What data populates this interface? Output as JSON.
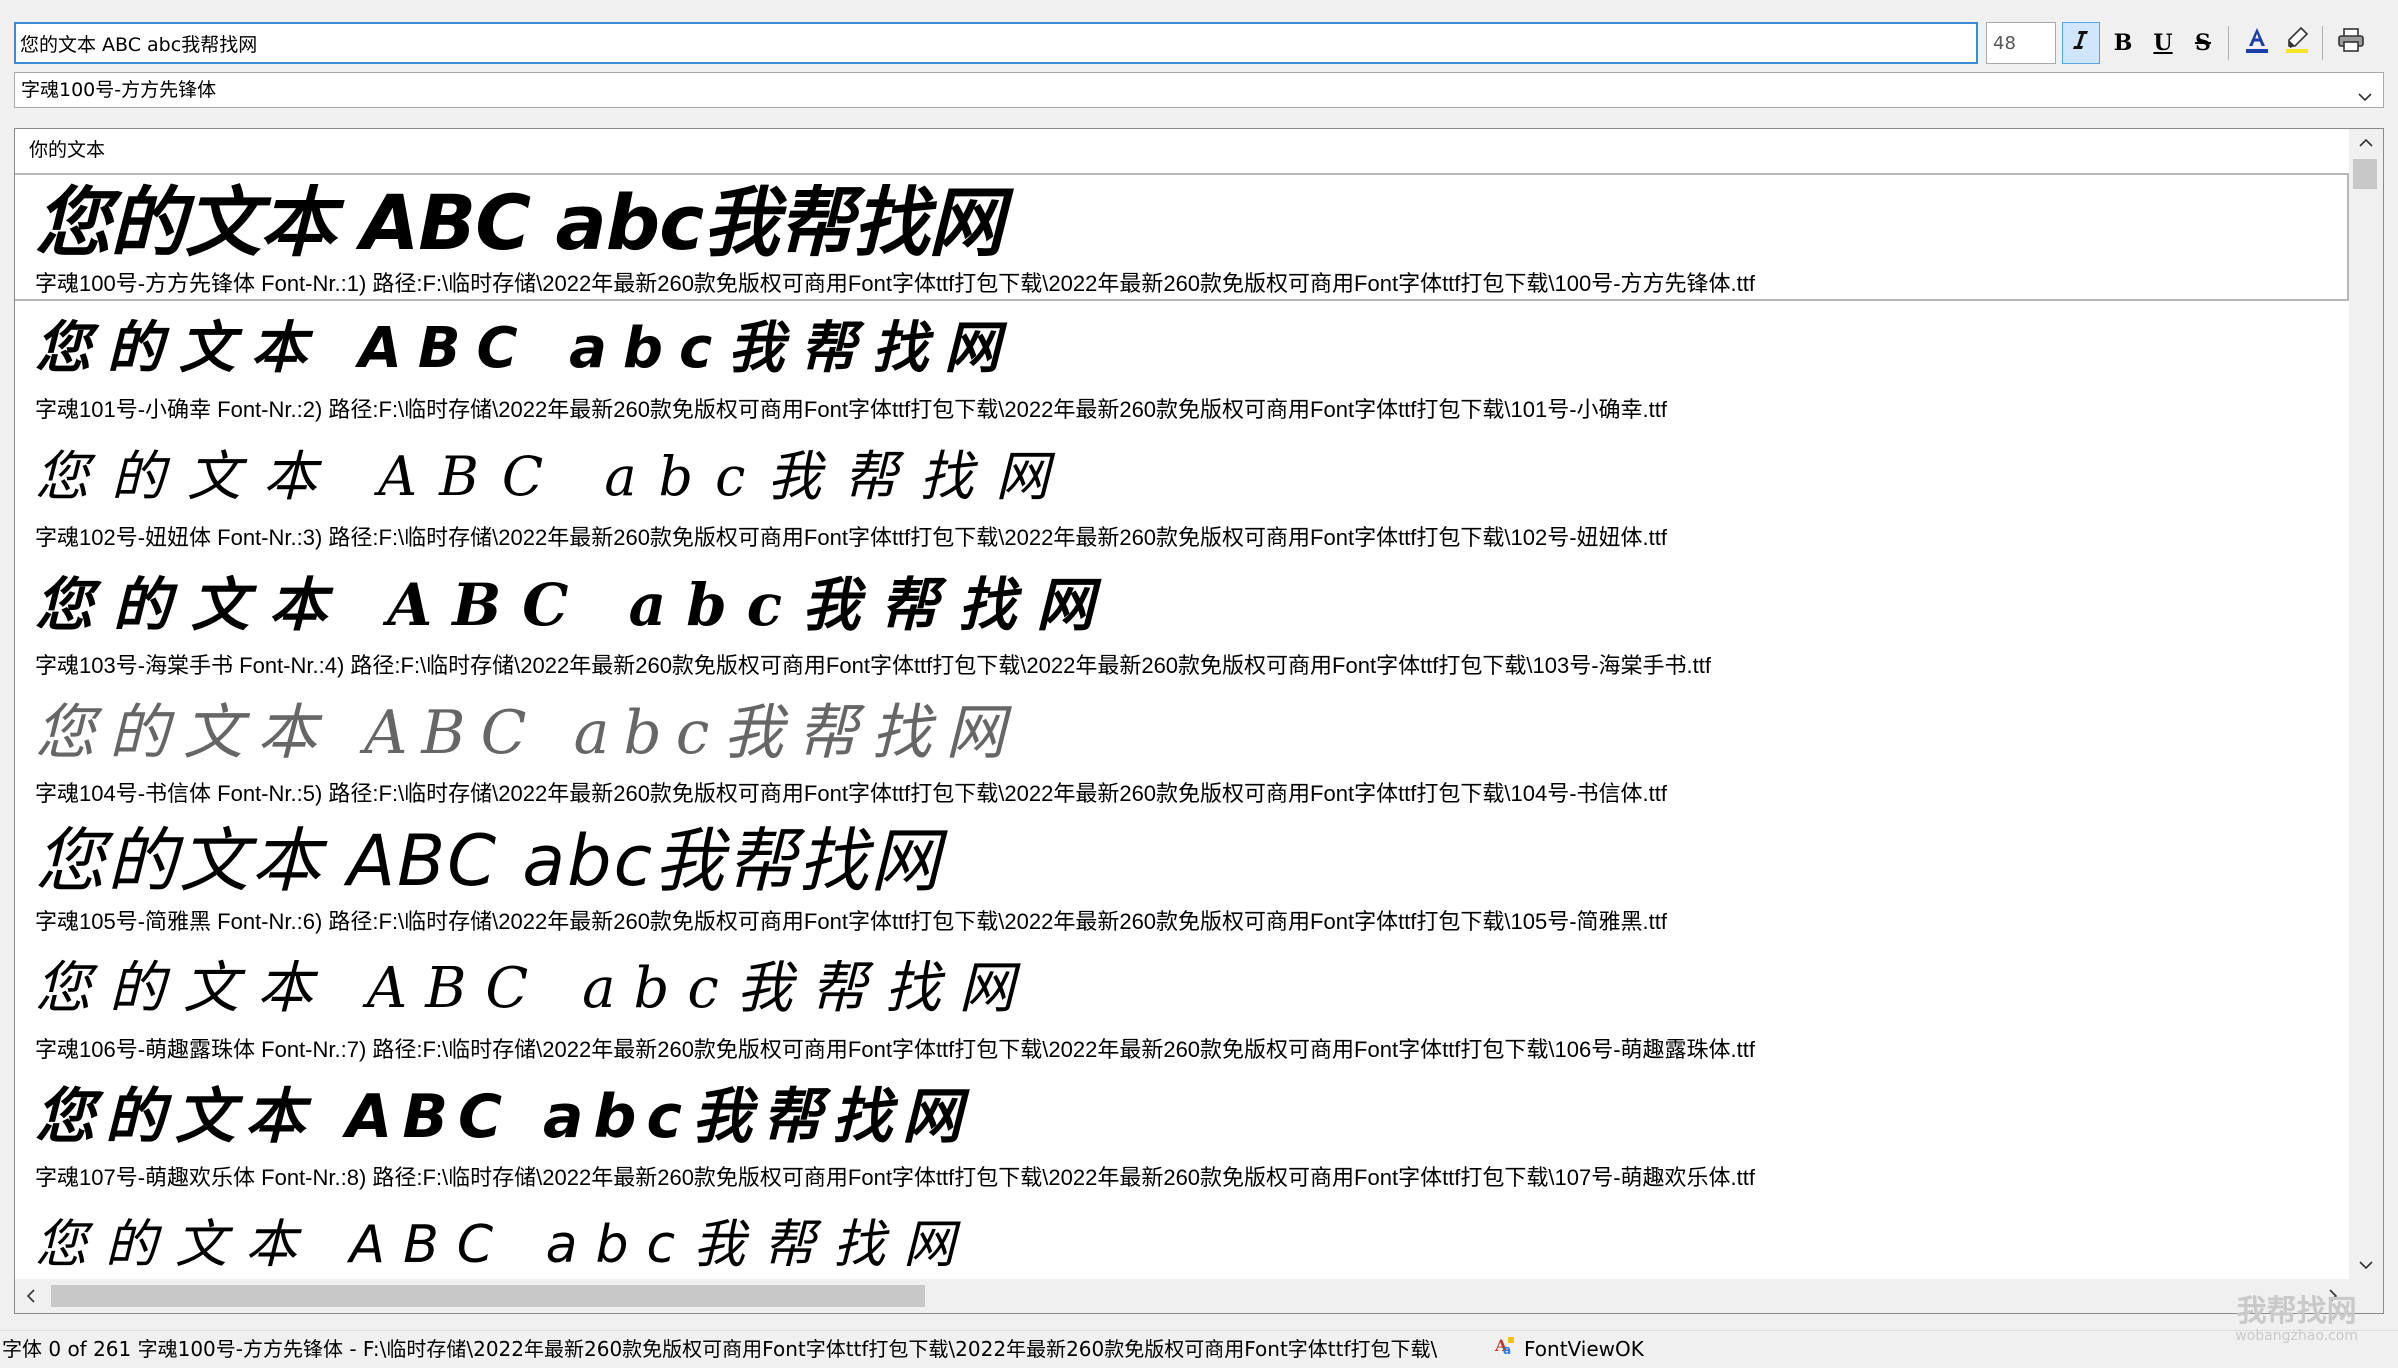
{
  "toolbar": {
    "text_value": "您的文本 ABC abc我帮找网",
    "size_value": "48",
    "italic_glyph": "I",
    "bold_glyph": "B",
    "underline_glyph": "U",
    "strike_glyph": "S"
  },
  "font_select": {
    "selected": "字魂100号-方方先锋体"
  },
  "preview": {
    "header": "你的文本",
    "fonts": [
      {
        "sample": "您的文本 ABC abc我帮找网",
        "info": "字魂100号-方方先锋体 Font-Nr.:1) 路径:F:\\临时存储\\2022年最新260款免版权可商用Font字体ttf打包下载\\2022年最新260款免版权可商用Font字体ttf打包下载\\100号-方方先锋体.ttf"
      },
      {
        "sample": "您的文本 ABC abc我帮找网",
        "info": "字魂101号-小确幸 Font-Nr.:2) 路径:F:\\临时存储\\2022年最新260款免版权可商用Font字体ttf打包下载\\2022年最新260款免版权可商用Font字体ttf打包下载\\101号-小确幸.ttf"
      },
      {
        "sample": "您的文本 ABC abc我帮找网",
        "info": "字魂102号-妞妞体 Font-Nr.:3) 路径:F:\\临时存储\\2022年最新260款免版权可商用Font字体ttf打包下载\\2022年最新260款免版权可商用Font字体ttf打包下载\\102号-妞妞体.ttf"
      },
      {
        "sample": "您的文本 ABC abc我帮找网",
        "info": "字魂103号-海棠手书 Font-Nr.:4) 路径:F:\\临时存储\\2022年最新260款免版权可商用Font字体ttf打包下载\\2022年最新260款免版权可商用Font字体ttf打包下载\\103号-海棠手书.ttf"
      },
      {
        "sample": "您的文本 ABC abc我帮找网",
        "info": "字魂104号-书信体 Font-Nr.:5) 路径:F:\\临时存储\\2022年最新260款免版权可商用Font字体ttf打包下载\\2022年最新260款免版权可商用Font字体ttf打包下载\\104号-书信体.ttf"
      },
      {
        "sample": "您的文本 ABC abc我帮找网",
        "info": "字魂105号-简雅黑 Font-Nr.:6) 路径:F:\\临时存储\\2022年最新260款免版权可商用Font字体ttf打包下载\\2022年最新260款免版权可商用Font字体ttf打包下载\\105号-简雅黑.ttf"
      },
      {
        "sample": "您的文本 ABC abc我帮找网",
        "info": "字魂106号-萌趣露珠体 Font-Nr.:7) 路径:F:\\临时存储\\2022年最新260款免版权可商用Font字体ttf打包下载\\2022年最新260款免版权可商用Font字体ttf打包下载\\106号-萌趣露珠体.ttf"
      },
      {
        "sample": "您的文本 ABC abc我帮找网",
        "info": "字魂107号-萌趣欢乐体 Font-Nr.:8) 路径:F:\\临时存储\\2022年最新260款免版权可商用Font字体ttf打包下载\\2022年最新260款免版权可商用Font字体ttf打包下载\\107号-萌趣欢乐体.ttf"
      },
      {
        "sample": "您的文本 ABC abc我帮找网",
        "info": ""
      }
    ]
  },
  "status": {
    "text": "字体 0 of 261 字魂100号-方方先锋体 - F:\\临时存储\\2022年最新260款免版权可商用Font字体ttf打包下载\\2022年最新260款免版权可商用Font字体ttf打包下载\\",
    "app_name": "FontViewOK"
  },
  "watermark": {
    "title": "我帮找网",
    "url": "wobangzhao.com"
  },
  "colors": {
    "accent": "#3c8ad8",
    "active_button_bg": "#cfe6fc",
    "font_color_underline": "#1a3fa8",
    "highlighter": "#f5e623"
  }
}
